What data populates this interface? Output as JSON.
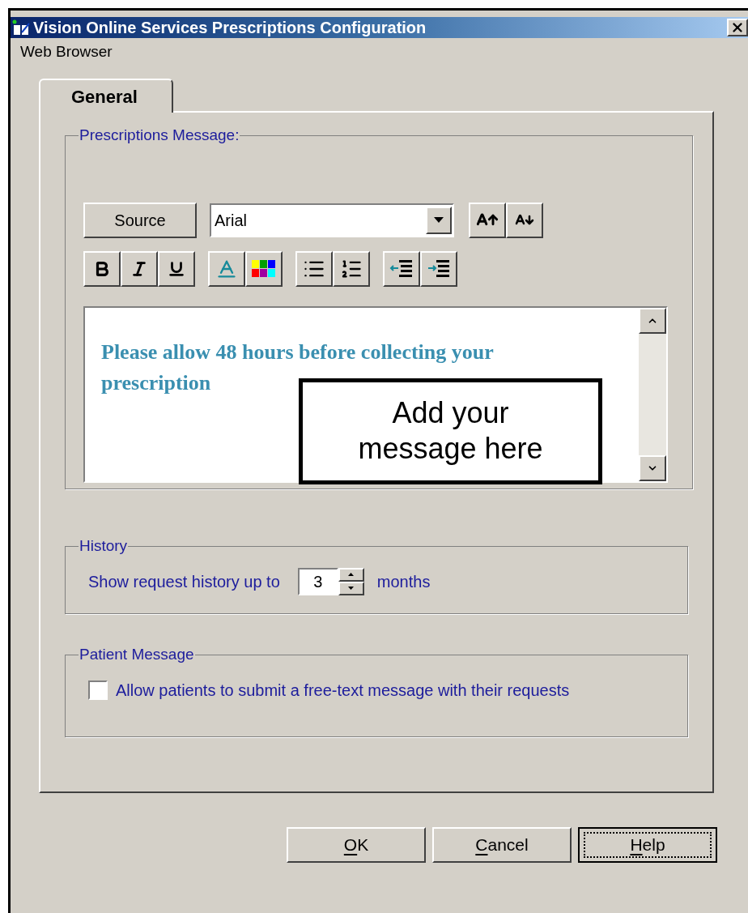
{
  "window": {
    "title": "Vision Online Services Prescriptions Configuration"
  },
  "menu_bar": [
    {
      "label": "Web Browser"
    }
  ],
  "tabs": [
    {
      "label": "General",
      "selected": true
    }
  ],
  "prescriptions_message": {
    "legend": "Prescriptions Message:",
    "source_button": "Source",
    "font": "Arial",
    "editor_text": "Please allow 48 hours before collecting your prescription",
    "callout": "Add your message here"
  },
  "history": {
    "legend": "History",
    "label": "Show request history up to",
    "value": "3",
    "unit": "months"
  },
  "patient_message": {
    "legend": "Patient Message",
    "checkbox": {
      "label": "Allow patients to submit a free-text message with their requests",
      "checked": false
    }
  },
  "buttons": [
    {
      "label": "OK",
      "focused": false
    },
    {
      "label": "Cancel",
      "focused": false
    },
    {
      "label": "Help",
      "focused": true
    }
  ]
}
